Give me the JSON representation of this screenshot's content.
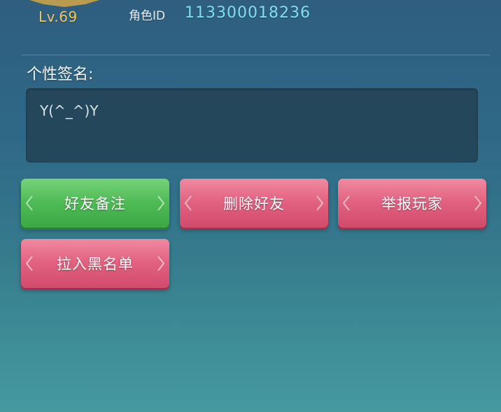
{
  "profile": {
    "level": "Lv.69",
    "role_id_label": "角色ID",
    "role_id_value": "113300018236"
  },
  "signature": {
    "label": "个性签名:",
    "text": "Y(^_^)Y"
  },
  "buttons": {
    "friend_note": "好友备注",
    "delete_friend": "删除好友",
    "report_player": "举报玩家",
    "blacklist": "拉入黑名单"
  },
  "colors": {
    "green_button": "#4ebb55",
    "red_button": "#e26180",
    "id_color": "#7fe0ea",
    "level_color": "#f2c75a"
  }
}
